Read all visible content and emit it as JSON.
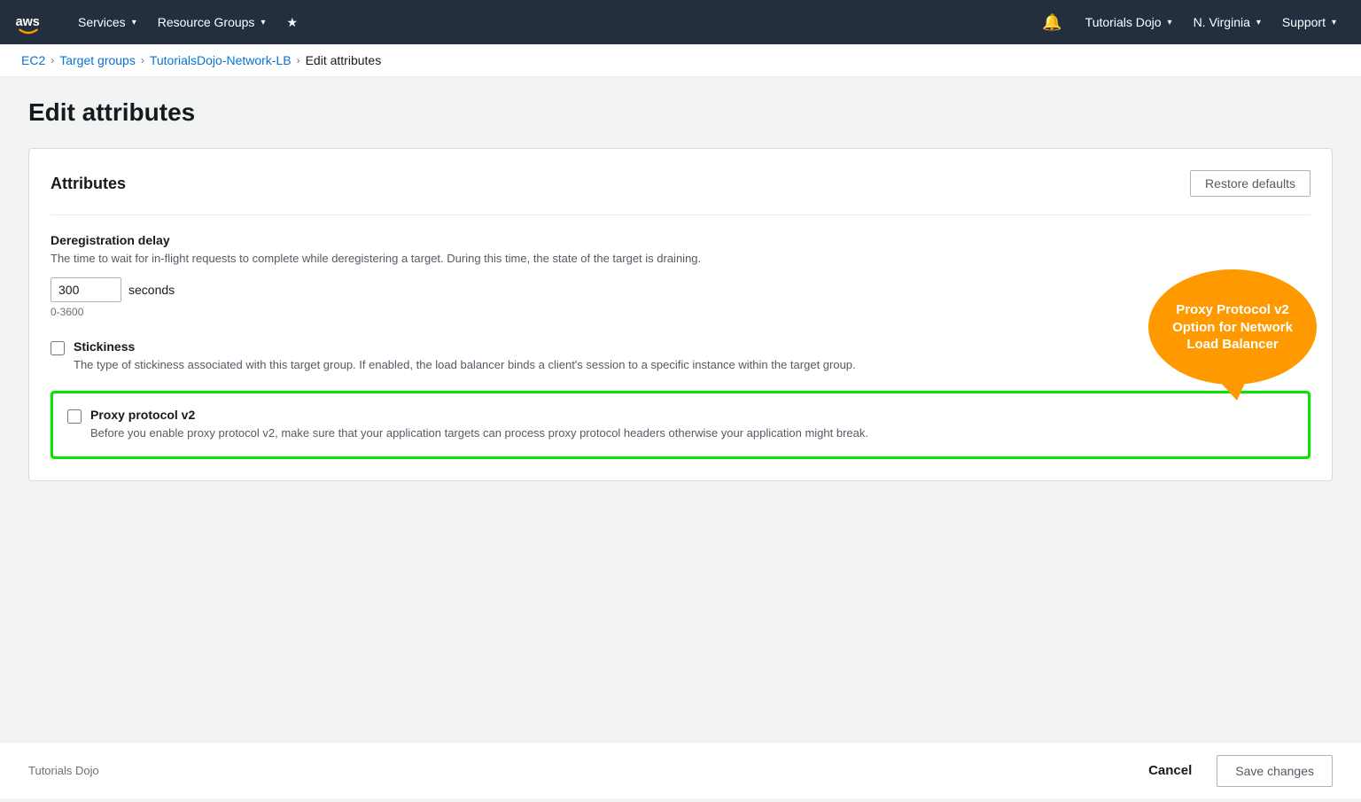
{
  "navbar": {
    "logo_alt": "AWS",
    "services_label": "Services",
    "resource_groups_label": "Resource Groups",
    "tutorials_dojo_label": "Tutorials Dojo",
    "region_label": "N. Virginia",
    "support_label": "Support"
  },
  "breadcrumb": {
    "ec2_label": "EC2",
    "target_groups_label": "Target groups",
    "lb_label": "TutorialsDojo-Network-LB",
    "current_label": "Edit attributes"
  },
  "page": {
    "title": "Edit attributes"
  },
  "card": {
    "attributes_title": "Attributes",
    "restore_defaults_label": "Restore defaults",
    "deregistration": {
      "title": "Deregistration delay",
      "description": "The time to wait for in-flight requests to complete while deregistering a target. During this time, the state of the target is draining.",
      "value": "300",
      "unit": "seconds",
      "range": "0-3600"
    },
    "stickiness": {
      "title": "Stickiness",
      "description": "The type of stickiness associated with this target group. If enabled, the load balancer binds a client's session to a specific instance within the target group.",
      "checked": false
    },
    "proxy_protocol": {
      "title": "Proxy protocol v2",
      "description": "Before you enable proxy protocol v2, make sure that your application targets can process proxy protocol headers otherwise your application might break.",
      "checked": false,
      "bubble_text": "Proxy Protocol v2 Option for Network Load Balancer"
    }
  },
  "footer": {
    "brand": "Tutorials Dojo",
    "cancel_label": "Cancel",
    "save_label": "Save changes"
  },
  "colors": {
    "highlight_green": "#00e600",
    "bubble_orange": "#f90",
    "link_blue": "#0972d3"
  }
}
